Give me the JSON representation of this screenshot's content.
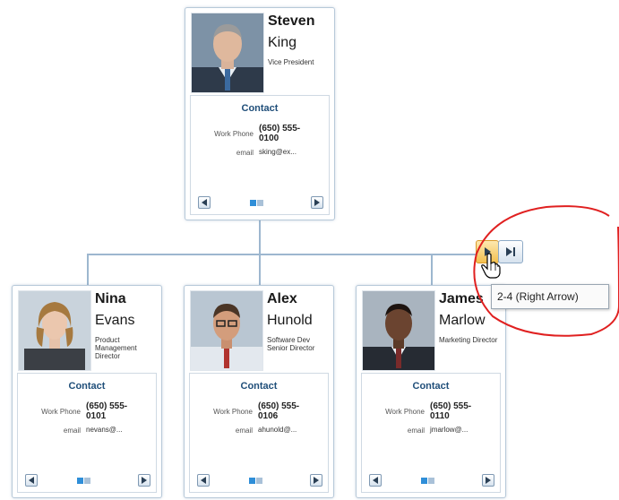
{
  "employees": [
    {
      "first": "Steven",
      "last": "King",
      "title": "Vice President",
      "contact_title": "Contact",
      "phone_label": "Work Phone",
      "phone": "(650) 555-0100",
      "email_label": "email",
      "email": "sking@ex..."
    },
    {
      "first": "Nina",
      "last": "Evans",
      "title": "Product Management Director",
      "contact_title": "Contact",
      "phone_label": "Work Phone",
      "phone": "(650) 555-0101",
      "email_label": "email",
      "email": "nevans@..."
    },
    {
      "first": "Alex",
      "last": "Hunold",
      "title": "Software Dev Senior Director",
      "contact_title": "Contact",
      "phone_label": "Work Phone",
      "phone": "(650) 555-0106",
      "email_label": "email",
      "email": "ahunold@..."
    },
    {
      "first": "James",
      "last": "Marlow",
      "title": "Marketing Director",
      "contact_title": "Contact",
      "phone_label": "Work Phone",
      "phone": "(650) 555-0110",
      "email_label": "email",
      "email": "jmarlow@..."
    }
  ],
  "tooltip": "2-4 (Right Arrow)",
  "icons": {
    "prev": "triangle-left-icon",
    "next": "triangle-right-icon",
    "last": "skip-to-end-icon",
    "cursor": "hand-pointer-icon"
  },
  "colors": {
    "accent": "#2f8ed8",
    "title_text": "#1f4e79",
    "highlight_button": "#f7c95a",
    "annotation": "#e02020"
  }
}
